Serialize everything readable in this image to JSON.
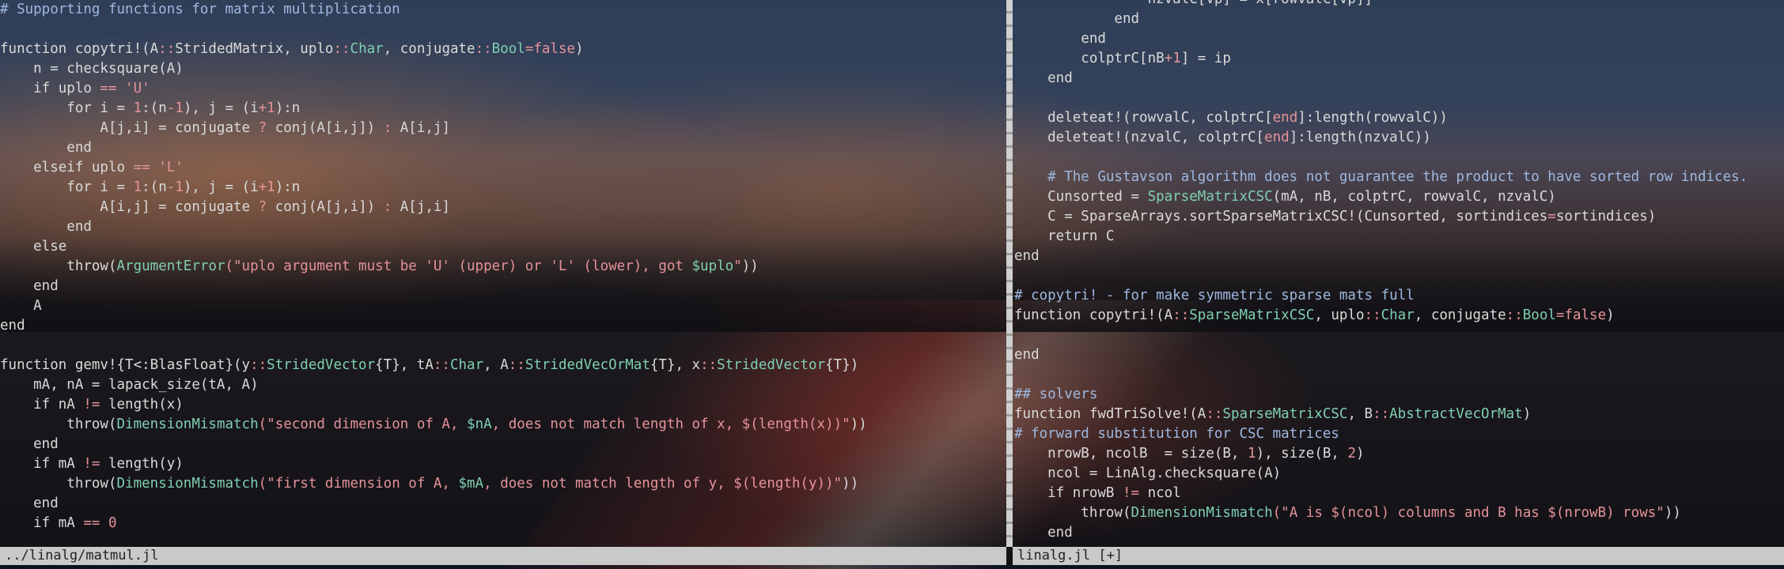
{
  "editor": {
    "left_pane": {
      "status": "../linalg/matmul.jl",
      "lines": [
        [
          {
            "t": "# Supporting functions for matrix multiplication",
            "c": "comment"
          }
        ],
        [],
        [
          {
            "t": "function copytri!(A"
          },
          {
            "t": "::",
            "c": "op"
          },
          {
            "t": "StridedMatrix, uplo"
          },
          {
            "t": "::",
            "c": "op"
          },
          {
            "t": "Char",
            "c": "type"
          },
          {
            "t": ", conjugate"
          },
          {
            "t": "::",
            "c": "op"
          },
          {
            "t": "Bool",
            "c": "type"
          },
          {
            "t": "=false",
            "c": "op"
          },
          {
            "t": ")"
          }
        ],
        [
          {
            "t": "    n = checksquare(A)"
          }
        ],
        [
          {
            "t": "    if uplo "
          },
          {
            "t": "==",
            "c": "op"
          },
          {
            "t": " "
          },
          {
            "t": "'U'",
            "c": "string"
          }
        ],
        [
          {
            "t": "        for i = "
          },
          {
            "t": "1",
            "c": "num"
          },
          {
            "t": ":(n"
          },
          {
            "t": "-1",
            "c": "num"
          },
          {
            "t": "), j = (i"
          },
          {
            "t": "+1",
            "c": "num"
          },
          {
            "t": "):n"
          }
        ],
        [
          {
            "t": "            A[j,i] = conjugate "
          },
          {
            "t": "?",
            "c": "op"
          },
          {
            "t": " conj(A[i,j]) "
          },
          {
            "t": ":",
            "c": "op"
          },
          {
            "t": " A[i,j]"
          }
        ],
        [
          {
            "t": "        end"
          }
        ],
        [
          {
            "t": "    elseif uplo "
          },
          {
            "t": "==",
            "c": "op"
          },
          {
            "t": " "
          },
          {
            "t": "'L'",
            "c": "string"
          }
        ],
        [
          {
            "t": "        for i = "
          },
          {
            "t": "1",
            "c": "num"
          },
          {
            "t": ":(n"
          },
          {
            "t": "-1",
            "c": "num"
          },
          {
            "t": "), j = (i"
          },
          {
            "t": "+1",
            "c": "num"
          },
          {
            "t": "):n"
          }
        ],
        [
          {
            "t": "            A[i,j] = conjugate "
          },
          {
            "t": "?",
            "c": "op"
          },
          {
            "t": " conj(A[j,i]) "
          },
          {
            "t": ":",
            "c": "op"
          },
          {
            "t": " A[j,i]"
          }
        ],
        [
          {
            "t": "        end"
          }
        ],
        [
          {
            "t": "    else"
          }
        ],
        [
          {
            "t": "        throw("
          },
          {
            "t": "ArgumentError",
            "c": "type"
          },
          {
            "t": "(\"uplo argument must be 'U' (upper) or 'L' (lower), got ",
            "c": "string"
          },
          {
            "t": "$uplo",
            "c": "interp"
          },
          {
            "t": "\"",
            "c": "string"
          },
          {
            "t": "))"
          }
        ],
        [
          {
            "t": "    end"
          }
        ],
        [
          {
            "t": "    A"
          }
        ],
        [
          {
            "t": "end"
          }
        ],
        [],
        [
          {
            "t": "function gemv!{T<:BlasFloat}(y"
          },
          {
            "t": "::",
            "c": "op"
          },
          {
            "t": "StridedVector",
            "c": "type"
          },
          {
            "t": "{T}, tA"
          },
          {
            "t": "::",
            "c": "op"
          },
          {
            "t": "Char",
            "c": "type"
          },
          {
            "t": ", A"
          },
          {
            "t": "::",
            "c": "op"
          },
          {
            "t": "StridedVecOrMat",
            "c": "type"
          },
          {
            "t": "{T}, x"
          },
          {
            "t": "::",
            "c": "op"
          },
          {
            "t": "StridedVector",
            "c": "type"
          },
          {
            "t": "{T})"
          }
        ],
        [
          {
            "t": "    mA, nA = lapack_size(tA, A)"
          }
        ],
        [
          {
            "t": "    if nA "
          },
          {
            "t": "!=",
            "c": "op"
          },
          {
            "t": " length(x)"
          }
        ],
        [
          {
            "t": "        throw("
          },
          {
            "t": "DimensionMismatch",
            "c": "type"
          },
          {
            "t": "(\"second dimension of A, ",
            "c": "string"
          },
          {
            "t": "$nA",
            "c": "interp"
          },
          {
            "t": ", does not match length of x, $(length(x))\"",
            "c": "string"
          },
          {
            "t": "))"
          }
        ],
        [
          {
            "t": "    end"
          }
        ],
        [
          {
            "t": "    if mA "
          },
          {
            "t": "!=",
            "c": "op"
          },
          {
            "t": " length(y)"
          }
        ],
        [
          {
            "t": "        throw("
          },
          {
            "t": "DimensionMismatch",
            "c": "type"
          },
          {
            "t": "(\"first dimension of A, ",
            "c": "string"
          },
          {
            "t": "$mA",
            "c": "interp"
          },
          {
            "t": ", does not match length of y, $(length(y))\"",
            "c": "string"
          },
          {
            "t": "))"
          }
        ],
        [
          {
            "t": "    end"
          }
        ],
        [
          {
            "t": "    if mA "
          },
          {
            "t": "==",
            "c": "op"
          },
          {
            "t": " "
          },
          {
            "t": "0",
            "c": "num"
          }
        ]
      ]
    },
    "right_pane": {
      "status": "linalg.jl [+]",
      "lines": [
        [
          {
            "t": "                nzvalC[vp] = x[rowvalC[vp]]"
          }
        ],
        [
          {
            "t": "            end"
          }
        ],
        [
          {
            "t": "        end"
          }
        ],
        [
          {
            "t": "        colptrC[nB"
          },
          {
            "t": "+1",
            "c": "num"
          },
          {
            "t": "] = ip"
          }
        ],
        [
          {
            "t": "    end"
          }
        ],
        [],
        [
          {
            "t": "    deleteat!(rowvalC, colptrC["
          },
          {
            "t": "end",
            "c": "string"
          },
          {
            "t": "]:length(rowvalC))"
          }
        ],
        [
          {
            "t": "    deleteat!(nzvalC, colptrC["
          },
          {
            "t": "end",
            "c": "string"
          },
          {
            "t": "]:length(nzvalC))"
          }
        ],
        [],
        [
          {
            "t": "    # The Gustavson algorithm does not guarantee the product to have sorted row indices.",
            "c": "comment"
          }
        ],
        [
          {
            "t": "    Cunsorted = "
          },
          {
            "t": "SparseMatrixCSC",
            "c": "type"
          },
          {
            "t": "(mA, nB, colptrC, rowvalC, nzvalC)"
          }
        ],
        [
          {
            "t": "    C = SparseArrays.sortSparseMatrixCSC!(Cunsorted, sortindices"
          },
          {
            "t": "=",
            "c": "op"
          },
          {
            "t": "sortindices)"
          }
        ],
        [
          {
            "t": "    return C"
          }
        ],
        [
          {
            "t": "end"
          }
        ],
        [],
        [
          {
            "t": "# copytri! - for make symmetric sparse mats full",
            "c": "comment"
          }
        ],
        [
          {
            "t": "function copytri!(A"
          },
          {
            "t": "::",
            "c": "op"
          },
          {
            "t": "SparseMatrixCSC",
            "c": "type"
          },
          {
            "t": ", uplo"
          },
          {
            "t": "::",
            "c": "op"
          },
          {
            "t": "Char",
            "c": "type"
          },
          {
            "t": ", conjugate"
          },
          {
            "t": "::",
            "c": "op"
          },
          {
            "t": "Bool",
            "c": "type"
          },
          {
            "t": "=false",
            "c": "op"
          },
          {
            "t": ")"
          }
        ],
        [],
        [
          {
            "t": "e",
            "c": "cursor"
          },
          {
            "t": "nd"
          }
        ],
        [],
        [
          {
            "t": "## solvers",
            "c": "comment"
          }
        ],
        [
          {
            "t": "function fwdTriSolve!(A"
          },
          {
            "t": "::",
            "c": "op"
          },
          {
            "t": "SparseMatrixCSC",
            "c": "type"
          },
          {
            "t": ", B"
          },
          {
            "t": "::",
            "c": "op"
          },
          {
            "t": "AbstractVecOrMat",
            "c": "type"
          },
          {
            "t": ")"
          }
        ],
        [
          {
            "t": "# forward substitution for CSC matrices",
            "c": "comment"
          }
        ],
        [
          {
            "t": "    nrowB, ncolB  = size(B, "
          },
          {
            "t": "1",
            "c": "num"
          },
          {
            "t": "), size(B, "
          },
          {
            "t": "2",
            "c": "num"
          },
          {
            "t": ")"
          }
        ],
        [
          {
            "t": "    ncol = LinAlg.checksquare(A)"
          }
        ],
        [
          {
            "t": "    if nrowB "
          },
          {
            "t": "!=",
            "c": "op"
          },
          {
            "t": " ncol"
          }
        ],
        [
          {
            "t": "        throw("
          },
          {
            "t": "DimensionMismatch",
            "c": "type"
          },
          {
            "t": "(\"A is $(ncol) columns and B has $(nrowB) rows\"",
            "c": "string"
          },
          {
            "t": "))"
          }
        ],
        [
          {
            "t": "    end"
          }
        ]
      ]
    }
  }
}
